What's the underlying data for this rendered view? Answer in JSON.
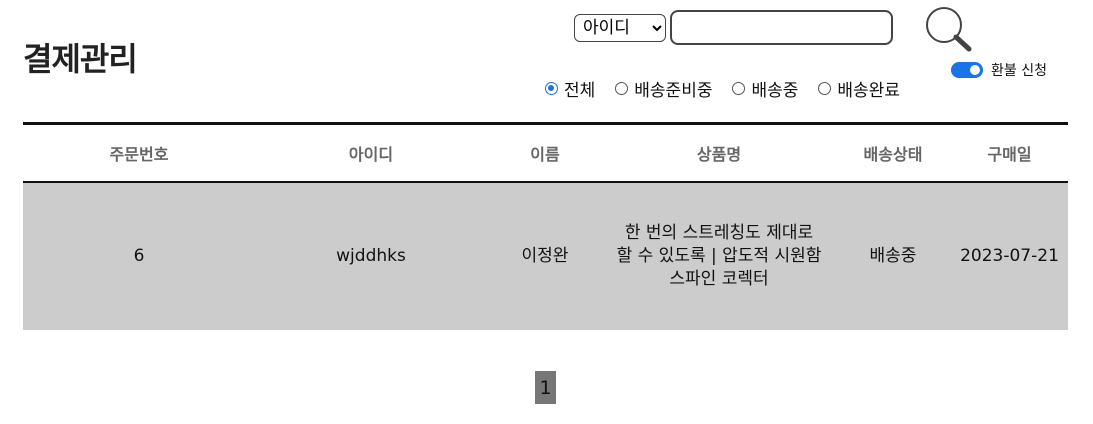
{
  "page": {
    "title": "결제관리"
  },
  "search": {
    "field_selected": "아이디",
    "query": "",
    "placeholder": ""
  },
  "refund_toggle": {
    "label": "환불 신청",
    "on": true
  },
  "filters": [
    {
      "label": "전체",
      "checked": true
    },
    {
      "label": "배송준비중",
      "checked": false
    },
    {
      "label": "배송중",
      "checked": false
    },
    {
      "label": "배송완료",
      "checked": false
    }
  ],
  "table": {
    "headers": [
      "주문번호",
      "아이디",
      "이름",
      "상품명",
      "배송상태",
      "구매일"
    ],
    "rows": [
      [
        "6",
        "wjddhks",
        "이정완",
        "한 번의 스트레칭도 제대로 할 수 있도록 | 압도적 시원함 스파인 코렉터",
        "배송중",
        "2023-07-21"
      ]
    ]
  },
  "pagination": {
    "current": "1"
  },
  "colors": {
    "accent": "#1a73e8",
    "row_bg": "#cccccc",
    "page_active": "#777777"
  },
  "icons": {
    "search": "search-icon"
  }
}
